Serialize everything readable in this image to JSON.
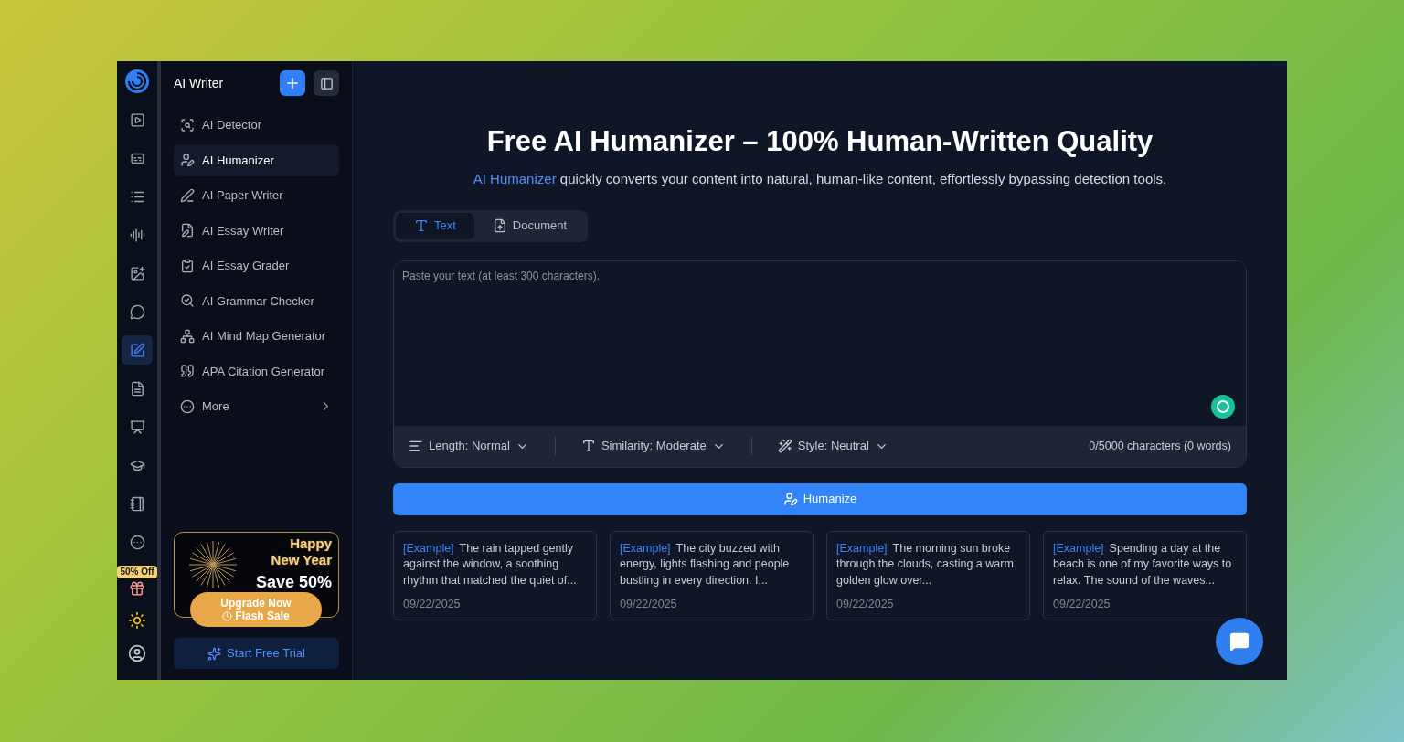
{
  "rail": {
    "items": [
      {
        "kind": "video",
        "selected": false
      },
      {
        "kind": "captions",
        "selected": false
      },
      {
        "kind": "list",
        "selected": false
      },
      {
        "kind": "audio",
        "selected": false
      },
      {
        "kind": "image",
        "selected": false
      },
      {
        "kind": "chat",
        "selected": false
      },
      {
        "kind": "writer",
        "selected": true
      },
      {
        "kind": "pdf",
        "selected": false
      },
      {
        "kind": "presentation",
        "selected": false
      },
      {
        "kind": "graduate",
        "selected": false
      },
      {
        "kind": "notebook",
        "selected": false
      },
      {
        "kind": "more",
        "selected": false
      }
    ],
    "offer_badge": "50% Off"
  },
  "sidebar": {
    "title": "AI Writer",
    "items": [
      {
        "kind": "detector",
        "label": "AI Detector",
        "selected": false
      },
      {
        "kind": "humanizer",
        "label": "AI Humanizer",
        "selected": true
      },
      {
        "kind": "paper",
        "label": "AI Paper Writer",
        "selected": false
      },
      {
        "kind": "essay",
        "label": "AI Essay Writer",
        "selected": false
      },
      {
        "kind": "grader",
        "label": "AI Essay Grader",
        "selected": false
      },
      {
        "kind": "grammar",
        "label": "AI Grammar Checker",
        "selected": false
      },
      {
        "kind": "mindmap",
        "label": "AI Mind Map Generator",
        "selected": false
      },
      {
        "kind": "citation",
        "label": "APA Citation Generator",
        "selected": false
      },
      {
        "kind": "more",
        "label": "More",
        "selected": false
      }
    ],
    "promo": {
      "headline": "Happy New Year",
      "offer": "Save 50%",
      "button": "Upgrade Now",
      "sub": "Flash Sale"
    },
    "trial_button": "Start Free Trial"
  },
  "main": {
    "title": "Free AI Humanizer – 100% Human-Written Quality",
    "subtitle_link": "AI Humanizer",
    "subtitle": "quickly converts your content into natural, human-like content, effortlessly bypassing detection tools.",
    "tabs": [
      {
        "kind": "text",
        "label": "Text",
        "selected": true
      },
      {
        "kind": "document",
        "label": "Document",
        "selected": false
      }
    ],
    "input": {
      "placeholder": "Paste your text (at least 300 characters)."
    },
    "options": [
      {
        "kind": "length",
        "label": "Length: Normal"
      },
      {
        "kind": "similarity",
        "label": "Similarity: Moderate"
      },
      {
        "kind": "style",
        "label": "Style: Neutral"
      }
    ],
    "counter": "0/5000 characters (0 words)",
    "action": "Humanize",
    "examples": [
      {
        "tag": "[Example]",
        "text": "The rain tapped gently against the window, a soothing rhythm that matched the quiet of...",
        "date": "09/22/2025"
      },
      {
        "tag": "[Example]",
        "text": "The city buzzed with energy, lights flashing and people bustling in every direction. I...",
        "date": "09/22/2025"
      },
      {
        "tag": "[Example]",
        "text": "The morning sun broke through the clouds, casting a warm golden glow over...",
        "date": "09/22/2025"
      },
      {
        "tag": "[Example]",
        "text": "Spending a day at the beach is one of my favorite ways to relax. The sound of the waves...",
        "date": "09/22/2025"
      }
    ]
  }
}
